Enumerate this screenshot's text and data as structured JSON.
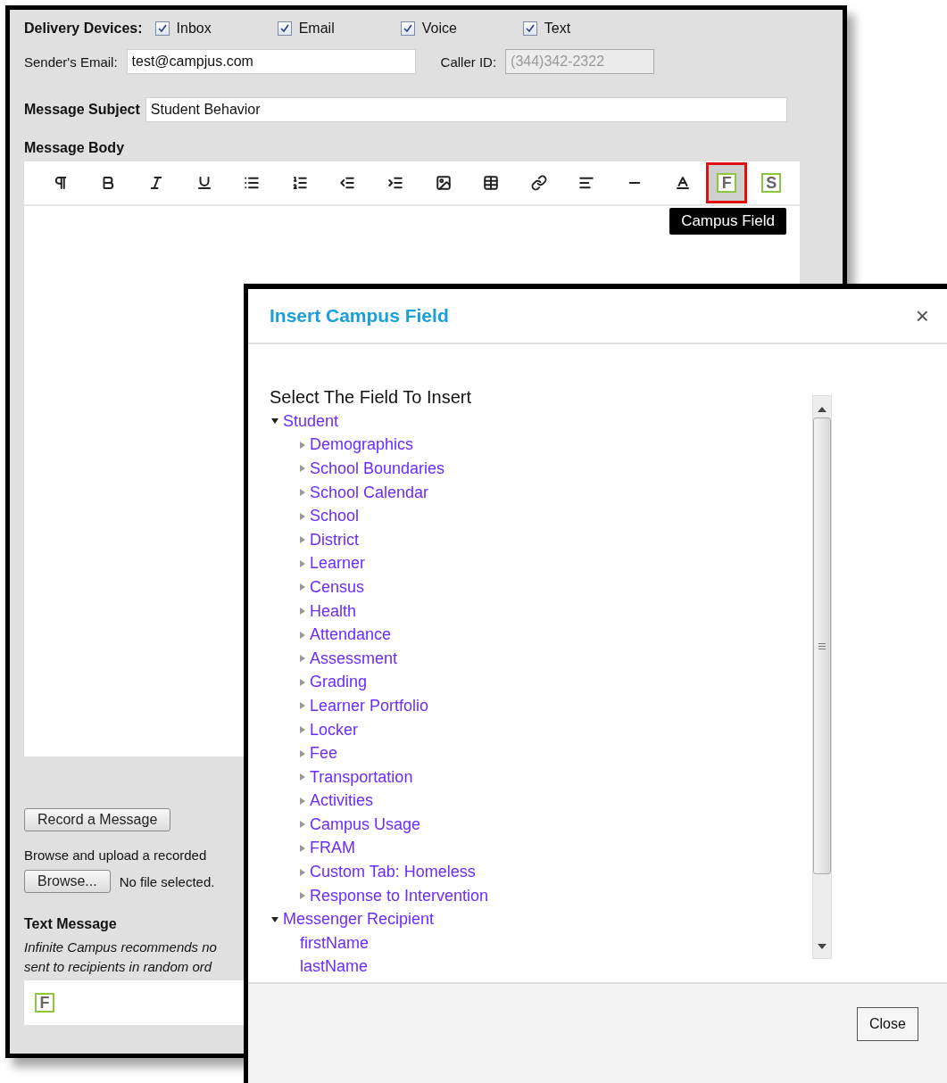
{
  "main_window": {
    "delivery": {
      "label": "Delivery Devices:",
      "devices": [
        {
          "label": "Inbox",
          "checked": true
        },
        {
          "label": "Email",
          "checked": true
        },
        {
          "label": "Voice",
          "checked": true
        },
        {
          "label": "Text",
          "checked": true
        }
      ]
    },
    "sender_email": {
      "label": "Sender's Email:",
      "value": "test@campjus.com"
    },
    "caller_id": {
      "label": "Caller ID:",
      "value": "(344)342-2322",
      "disabled": true
    },
    "subject": {
      "label": "Message Subject",
      "value": "Student Behavior"
    },
    "body_label": "Message Body",
    "field_buttons": [
      {
        "letter": "F",
        "selected": true
      },
      {
        "letter": "S",
        "selected": false
      }
    ],
    "tooltip": "Campus Field",
    "record_button": "Record a Message",
    "upload_text": "Browse and upload a recorded",
    "browse_button": "Browse...",
    "file_status": "No file selected.",
    "text_message_label": "Text Message",
    "text_message_note": [
      "Infinite Campus recommends no",
      "sent to recipients in random ord"
    ],
    "text_field_button": "F"
  },
  "dialog": {
    "title": "Insert Campus Field",
    "close_icon": "×",
    "prompt": "Select The Field To Insert",
    "tree": [
      {
        "label": "Student",
        "expanded": true,
        "children": [
          {
            "label": "Demographics",
            "expanded": false
          },
          {
            "label": "School Boundaries",
            "expanded": false
          },
          {
            "label": "School Calendar",
            "expanded": false
          },
          {
            "label": "School",
            "expanded": false
          },
          {
            "label": "District",
            "expanded": false
          },
          {
            "label": "Learner",
            "expanded": false
          },
          {
            "label": "Census",
            "expanded": false
          },
          {
            "label": "Health",
            "expanded": false
          },
          {
            "label": "Attendance",
            "expanded": false
          },
          {
            "label": "Assessment",
            "expanded": false
          },
          {
            "label": "Grading",
            "expanded": false
          },
          {
            "label": "Learner Portfolio",
            "expanded": false
          },
          {
            "label": "Locker",
            "expanded": false
          },
          {
            "label": "Fee",
            "expanded": false
          },
          {
            "label": "Transportation",
            "expanded": false
          },
          {
            "label": "Activities",
            "expanded": false
          },
          {
            "label": "Campus Usage",
            "expanded": false
          },
          {
            "label": "FRAM",
            "expanded": false
          },
          {
            "label": "Custom Tab: Homeless",
            "expanded": false
          },
          {
            "label": "Response to Intervention",
            "expanded": false
          }
        ]
      },
      {
        "label": "Messenger Recipient",
        "expanded": true,
        "children": [
          {
            "label": "firstName"
          },
          {
            "label": "lastName"
          }
        ]
      }
    ],
    "close_button": "Close"
  }
}
